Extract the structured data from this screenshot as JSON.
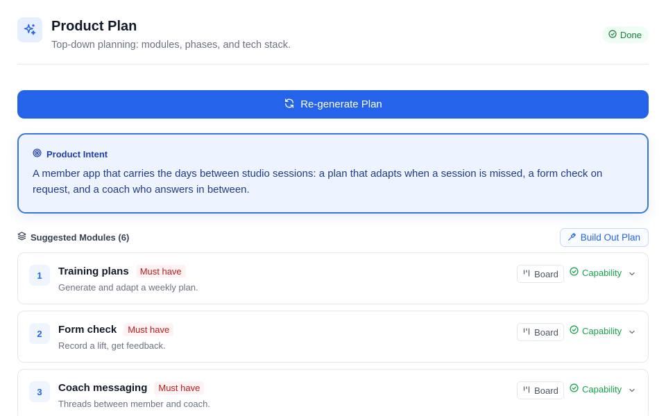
{
  "header": {
    "title": "Product Plan",
    "subtitle": "Top-down planning: modules, phases, and tech stack.",
    "icon": "sparkles-icon",
    "status": "Done"
  },
  "actions": {
    "regenerate_label": "Re-generate Plan",
    "build_label": "Build Out Plan"
  },
  "intent": {
    "label": "Product Intent",
    "text": "A member app that carries the days between studio sessions: a plan that adapts when a session is missed, a form check on request, and a coach who answers in between."
  },
  "modules": {
    "heading": "Suggested Modules (6)",
    "items": [
      {
        "number": "1",
        "title": "Training plans",
        "priority": "Must have",
        "description": "Generate and adapt a weekly plan.",
        "board_label": "Board",
        "type": "Capability"
      },
      {
        "number": "2",
        "title": "Form check",
        "priority": "Must have",
        "description": "Record a lift, get feedback.",
        "board_label": "Board",
        "type": "Capability"
      },
      {
        "number": "3",
        "title": "Coach messaging",
        "priority": "Must have",
        "description": "Threads between member and coach.",
        "board_label": "Board",
        "type": "Capability"
      }
    ]
  },
  "colors": {
    "accent": "#2563eb",
    "intent_bg": "#eef4ff",
    "success": "#16a34a",
    "priority": "#b91c1c"
  }
}
